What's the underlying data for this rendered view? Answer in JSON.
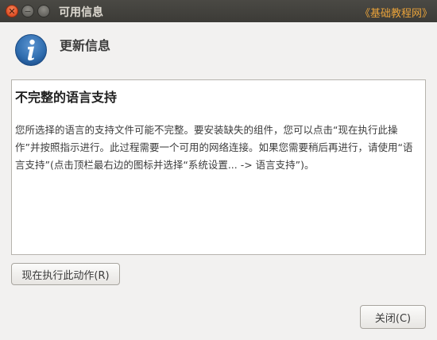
{
  "window": {
    "title": "可用信息",
    "watermark": "《基础教程网》"
  },
  "titlebar_buttons": {
    "close_icon": "close-icon",
    "minimize_icon": "minimize-icon",
    "maximize_icon": "maximize-icon"
  },
  "header": {
    "icon": "info-icon",
    "title": "更新信息"
  },
  "message": {
    "title": "不完整的语言支持",
    "body": "您所选择的语言的支持文件可能不完整。要安装缺失的组件，您可以点击“现在执行此操作”并按照指示进行。此过程需要一个可用的网络连接。如果您需要稍后再进行，请使用“语言支持”(点击顶栏最右边的图标并选择“系统设置... -> 语言支持”)。"
  },
  "buttons": {
    "action_label": "现在执行此动作(R)",
    "close_label": "关闭(C)"
  },
  "colors": {
    "titlebar": "#3c3b37",
    "close_button": "#e1552b",
    "watermark": "#e8a23a",
    "info_icon": "#2f6daf"
  }
}
